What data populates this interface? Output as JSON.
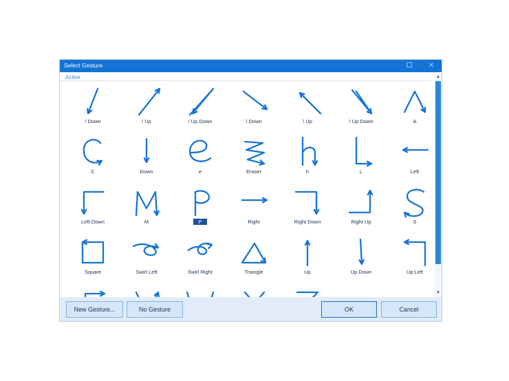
{
  "dialog": {
    "title": "Select Gesture",
    "maximize_glyph": "☐",
    "close_glyph": "✕",
    "group_label": "Active",
    "scroll_up_glyph": "▲",
    "scroll_down_glyph": "▼"
  },
  "gestures": [
    {
      "label": "/ Down",
      "icon": "slash-down-icon"
    },
    {
      "label": "/ Up",
      "icon": "slash-up-icon"
    },
    {
      "label": "/ Up Down",
      "icon": "slash-up-down-icon"
    },
    {
      "label": "\\ Down",
      "icon": "backslash-down-icon"
    },
    {
      "label": "\\ Up",
      "icon": "backslash-up-icon"
    },
    {
      "label": "\\ Up Down",
      "icon": "backslash-up-down-icon"
    },
    {
      "label": "A",
      "icon": "letter-a-icon"
    },
    {
      "label": "C",
      "icon": "letter-c-icon"
    },
    {
      "label": "Down",
      "icon": "down-arrow-icon"
    },
    {
      "label": "e",
      "icon": "letter-e-icon"
    },
    {
      "label": "Eraser",
      "icon": "eraser-scribble-icon"
    },
    {
      "label": "h",
      "icon": "letter-h-icon"
    },
    {
      "label": "L",
      "icon": "letter-l-icon"
    },
    {
      "label": "Left",
      "icon": "left-arrow-icon"
    },
    {
      "label": "Left Down",
      "icon": "left-down-arrow-icon"
    },
    {
      "label": "M",
      "icon": "letter-m-icon"
    },
    {
      "label": "P",
      "icon": "letter-p-icon",
      "selected": true
    },
    {
      "label": "Right",
      "icon": "right-arrow-icon"
    },
    {
      "label": "Right Down",
      "icon": "right-down-arrow-icon"
    },
    {
      "label": "Right Up",
      "icon": "right-up-arrow-icon"
    },
    {
      "label": "S",
      "icon": "letter-s-icon"
    },
    {
      "label": "Square",
      "icon": "square-icon"
    },
    {
      "label": "Swirl Left",
      "icon": "swirl-left-icon"
    },
    {
      "label": "Swirl Right",
      "icon": "swirl-right-icon"
    },
    {
      "label": "Triangle",
      "icon": "triangle-icon"
    },
    {
      "label": "Up",
      "icon": "up-arrow-icon"
    },
    {
      "label": "Up Down",
      "icon": "up-down-arrow-icon"
    },
    {
      "label": "Up Left",
      "icon": "up-left-arrow-icon"
    },
    {
      "label": "",
      "icon": "up-right-arrow-icon"
    },
    {
      "label": "",
      "icon": "letter-v-icon"
    },
    {
      "label": "",
      "icon": "letter-w-icon"
    },
    {
      "label": "",
      "icon": "letter-x-icon"
    },
    {
      "label": "",
      "icon": "letter-z-icon"
    }
  ],
  "buttons": {
    "new_gesture": "New Gesture...",
    "no_gesture": "No Gesture",
    "ok": "OK",
    "cancel": "Cancel"
  },
  "colors": {
    "accent": "#1473d6",
    "stroke": "#1675d4",
    "footer": "#e2ecf8"
  }
}
